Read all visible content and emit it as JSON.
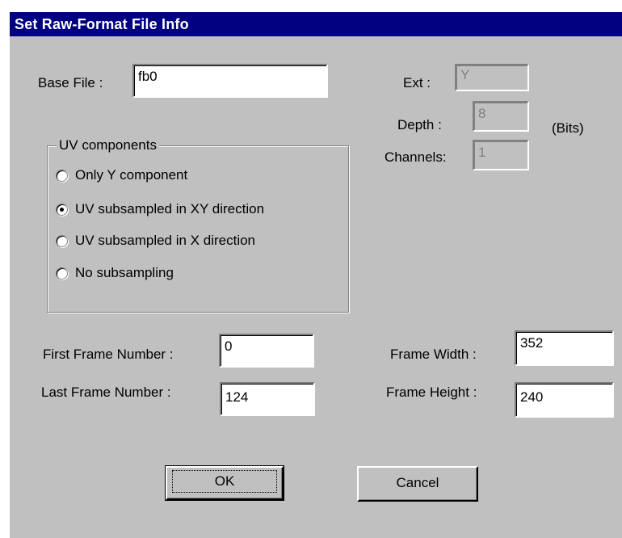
{
  "dialog": {
    "title": "Set Raw-Format File Info",
    "base_file": {
      "label": "Base File :",
      "value": "fb0"
    },
    "ext": {
      "label": "Ext :",
      "value": "Y"
    },
    "depth": {
      "label": "Depth :",
      "value": "8",
      "unit": "(Bits)"
    },
    "channels": {
      "label": "Channels:",
      "value": "1"
    },
    "uv_group": {
      "label": "UV components",
      "options": [
        {
          "label": "Only Y component",
          "selected": false
        },
        {
          "label": "UV subsampled in XY direction",
          "selected": true
        },
        {
          "label": "UV subsampled in X direction",
          "selected": false
        },
        {
          "label": "No subsampling",
          "selected": false
        }
      ]
    },
    "first_frame": {
      "label": "First Frame Number :",
      "value": "0"
    },
    "last_frame": {
      "label": "Last Frame Number :",
      "value": "124"
    },
    "frame_width": {
      "label": "Frame Width :",
      "value": "352"
    },
    "frame_height": {
      "label": "Frame Height :",
      "value": "240"
    },
    "ok_label": "OK",
    "cancel_label": "Cancel"
  }
}
